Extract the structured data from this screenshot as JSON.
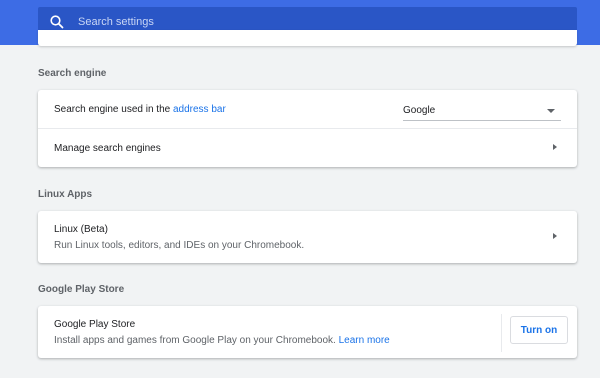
{
  "search": {
    "placeholder": "Search settings"
  },
  "sections": {
    "search_engine": {
      "title": "Search engine",
      "engine_row": {
        "label_prefix": "Search engine used in the ",
        "link": "address bar",
        "selected": "Google"
      },
      "manage_row": {
        "label": "Manage search engines"
      }
    },
    "linux_apps": {
      "title": "Linux Apps",
      "row": {
        "label": "Linux (Beta)",
        "sublabel": "Run Linux tools, editors, and IDEs on your Chromebook."
      }
    },
    "play_store": {
      "title": "Google Play Store",
      "row": {
        "label": "Google Play Store",
        "sublabel": "Install apps and games from Google Play on your Chromebook.",
        "link": "Learn more",
        "button": "Turn on"
      }
    }
  },
  "colors": {
    "header": "#3d6ce5",
    "search_box": "#2a56c6",
    "accent": "#1a73e8",
    "background": "#f1f3f4"
  },
  "icons": {
    "search": "search-icon",
    "arrow": "arrow-right-icon",
    "dropdown": "dropdown-arrow-icon"
  }
}
